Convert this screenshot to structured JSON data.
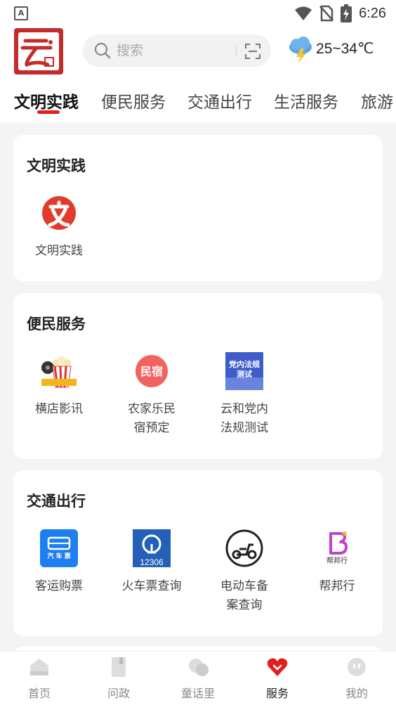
{
  "status_bar": {
    "time": "6:26",
    "indicator": "A"
  },
  "header": {
    "logo_icon": "yunhe-logo-icon",
    "search": {
      "placeholder": "搜索"
    },
    "weather": {
      "icon": "thunderstorm-icon",
      "temperature": "25~34℃"
    }
  },
  "tabs": [
    {
      "label": "文明实践",
      "active": true
    },
    {
      "label": "便民服务",
      "active": false
    },
    {
      "label": "交通出行",
      "active": false
    },
    {
      "label": "生活服务",
      "active": false
    },
    {
      "label": "旅游",
      "active": false
    }
  ],
  "sections": [
    {
      "title": "文明实践",
      "items": [
        {
          "label": "文明实践",
          "icon": "civilization-practice-icon"
        }
      ]
    },
    {
      "title": "便民服务",
      "items": [
        {
          "label": "横店影讯",
          "icon": "cinema-popcorn-icon"
        },
        {
          "label": "农家乐民宿预定",
          "line1": "农家乐民",
          "line2": "宿预定",
          "icon": "homestay-icon",
          "icon_text": "民宿"
        },
        {
          "label": "云和党内法规测试",
          "line1": "云和党内",
          "line2": "法规测试",
          "icon": "party-regulation-test-icon",
          "icon_text_1": "党内法规",
          "icon_text_2": "测试"
        }
      ]
    },
    {
      "title": "交通出行",
      "items": [
        {
          "label": "客运购票",
          "icon": "bus-ticket-icon",
          "icon_text": "汽 车 票"
        },
        {
          "label": "火车票查询",
          "icon": "railway-12306-icon",
          "icon_text": "12306"
        },
        {
          "label": "电动车备案查询",
          "line1": "电动车备",
          "line2": "案查询",
          "icon": "electric-scooter-icon"
        },
        {
          "label": "帮邦行",
          "icon": "bangbangxing-icon",
          "icon_text": "帮邦行"
        }
      ]
    }
  ],
  "bottom_nav": [
    {
      "label": "首页",
      "icon": "home-icon",
      "active": false
    },
    {
      "label": "问政",
      "icon": "book-icon",
      "active": false
    },
    {
      "label": "童话里",
      "icon": "fairytale-icon",
      "active": false
    },
    {
      "label": "服务",
      "icon": "heart-service-icon",
      "active": true
    },
    {
      "label": "我的",
      "icon": "profile-icon",
      "active": false
    }
  ],
  "colors": {
    "accent": "#e02020",
    "brand_red": "#c42b2b",
    "bus_blue": "#1e7ff0",
    "rail_blue": "#2560b8"
  }
}
